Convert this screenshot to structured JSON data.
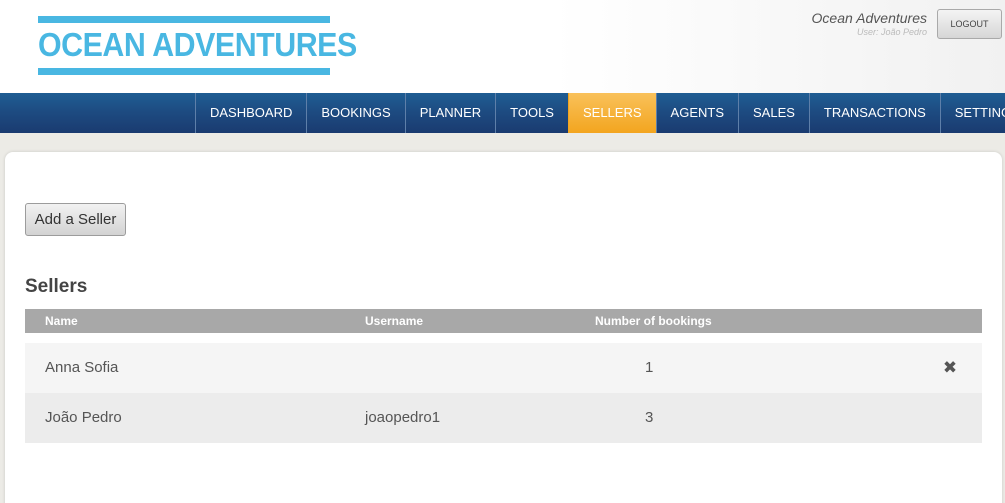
{
  "header": {
    "logo_text": "OCEAN ADVENTURES",
    "company": "Ocean Adventures",
    "user": "User: João Pedro",
    "logout_label": "LOGOUT"
  },
  "nav": {
    "items": [
      "DASHBOARD",
      "BOOKINGS",
      "PLANNER",
      "TOOLS",
      "SELLERS",
      "AGENTS",
      "SALES",
      "TRANSACTIONS",
      "SETTINGS"
    ],
    "active": "SELLERS"
  },
  "main": {
    "add_button_label": "Add a Seller",
    "section_title": "Sellers",
    "table": {
      "headers": [
        "Name",
        "Username",
        "Number of bookings"
      ],
      "rows": [
        {
          "name": "Anna Sofia",
          "username": "",
          "bookings": "1",
          "deletable": true
        },
        {
          "name": "João Pedro",
          "username": "joaopedro1",
          "bookings": "3",
          "deletable": false
        }
      ]
    },
    "delete_icon_glyph": "✖"
  },
  "colors": {
    "brand_blue": "#49b7e2",
    "nav_blue": "#1d4a80",
    "active_tab": "#f3a51f",
    "table_header": "#a8a8a8"
  }
}
